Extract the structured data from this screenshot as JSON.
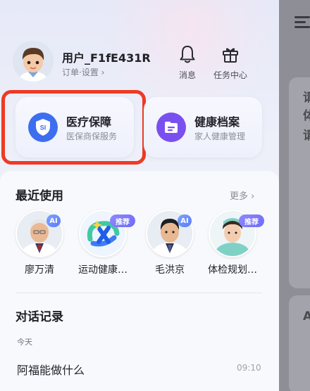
{
  "profile": {
    "username": "用户_F1fE431R",
    "sublinks": "订单·设置 ›"
  },
  "top_actions": [
    {
      "label": "消息",
      "icon": "bell-icon"
    },
    {
      "label": "任务中心",
      "icon": "gift-icon"
    }
  ],
  "service_cards": [
    {
      "title": "医疗保障",
      "subtitle": "医保商保服务",
      "icon": "shield-si-icon",
      "icon_text": "SI",
      "color": "#3d6ef0"
    },
    {
      "title": "健康档案",
      "subtitle": "家人健康管理",
      "icon": "folder-icon",
      "color": "#7a4ff0"
    }
  ],
  "recent": {
    "title": "最近使用",
    "more": "更多 ›",
    "items": [
      {
        "label": "廖万清",
        "badge": "AI"
      },
      {
        "label": "运动健康…",
        "badge": "推荐"
      },
      {
        "label": "毛洪京",
        "badge": "AI"
      },
      {
        "label": "体检规划…",
        "badge": "推荐"
      }
    ]
  },
  "history": {
    "title": "对话记录",
    "day": "今天",
    "items": [
      {
        "title": "阿福能做什么",
        "time": "09:10"
      }
    ]
  },
  "underlay": {
    "glyphs": [
      "请",
      "体",
      "请",
      "A"
    ]
  }
}
